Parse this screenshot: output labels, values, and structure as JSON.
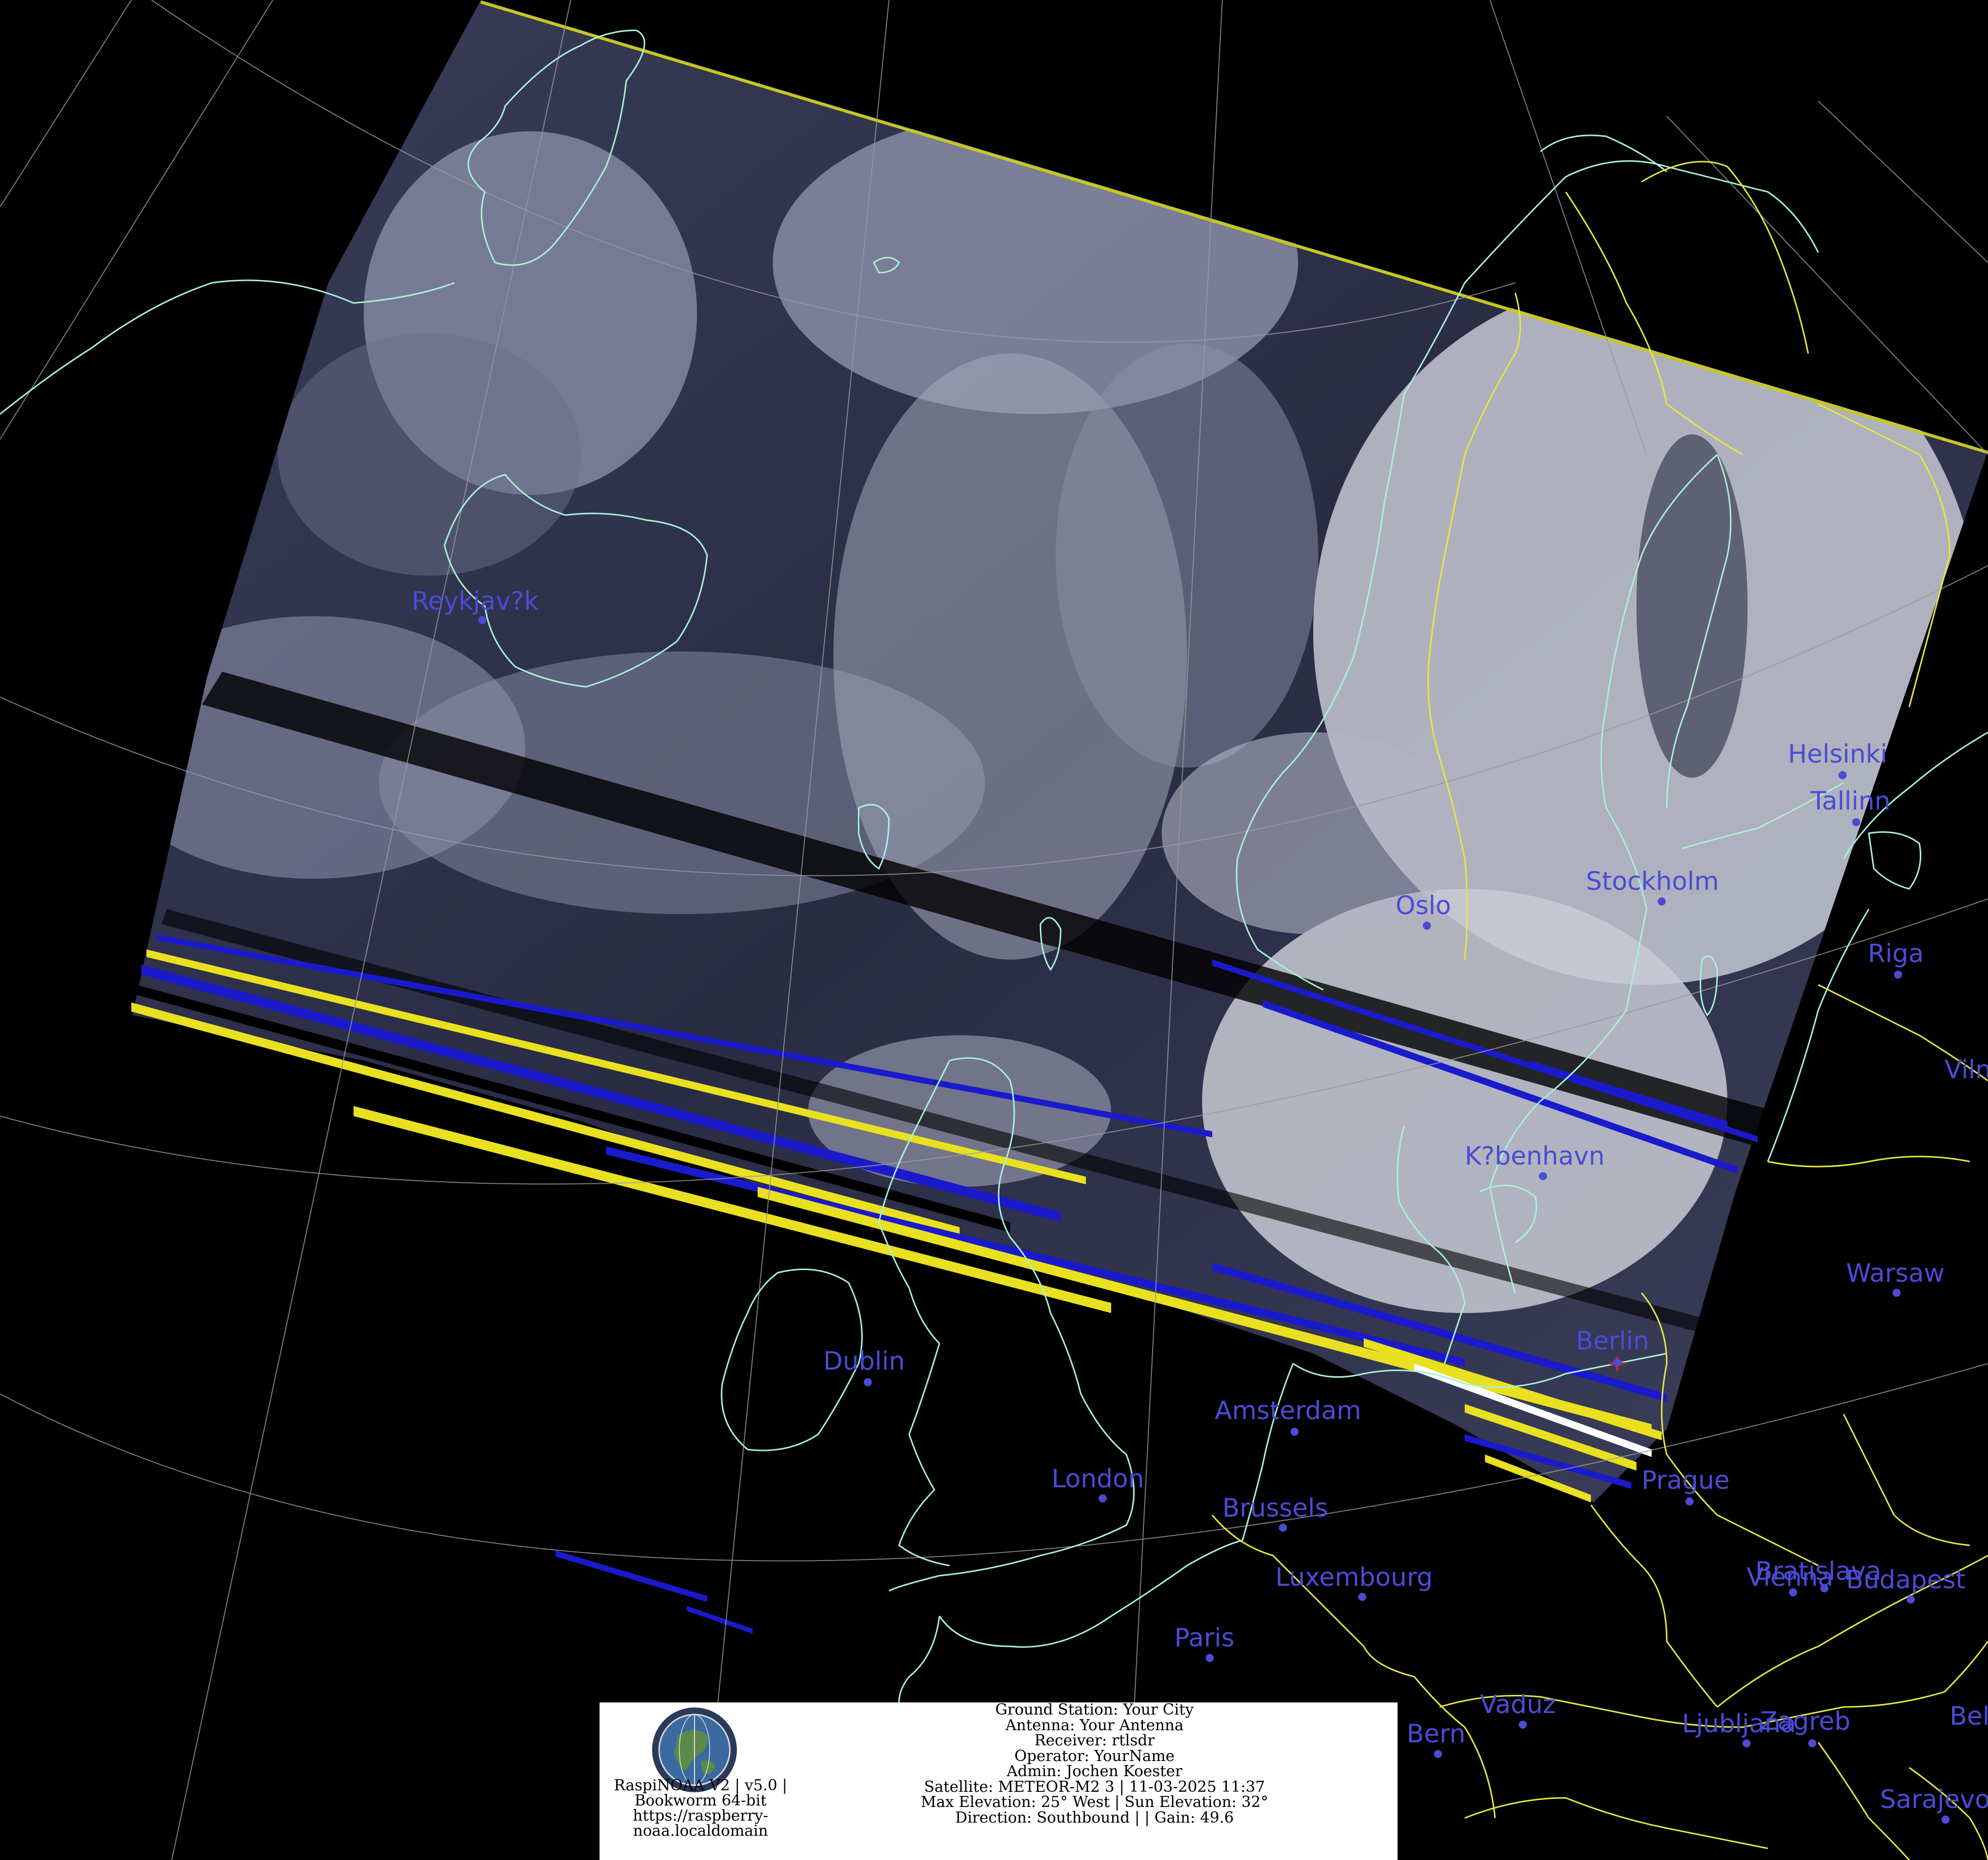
{
  "colors": {
    "background": "#000000",
    "coastline": "#a8f0d8",
    "border": "#e6e640",
    "graticule": "#9a9a9a",
    "city": "#4b4bd6",
    "home_marker": "#d02020",
    "swath_edge": "#c8c820",
    "artifact_blue": "#1a1acc",
    "artifact_yellow": "#e8e020"
  },
  "map": {
    "cities": [
      {
        "name": "Reykjav?k"
      },
      {
        "name": "Helsinki"
      },
      {
        "name": "Tallinn"
      },
      {
        "name": "Stockholm"
      },
      {
        "name": "Oslo"
      },
      {
        "name": "Riga"
      },
      {
        "name": "Vilnius"
      },
      {
        "name": "K?benhavn"
      },
      {
        "name": "Warsaw"
      },
      {
        "name": "Berlin"
      },
      {
        "name": "Dublin"
      },
      {
        "name": "Amsterdam"
      },
      {
        "name": "London"
      },
      {
        "name": "Brussels"
      },
      {
        "name": "Prague"
      },
      {
        "name": "Bratislava"
      },
      {
        "name": "Vienna"
      },
      {
        "name": "Budapest"
      },
      {
        "name": "Luxembourg"
      },
      {
        "name": "Paris"
      },
      {
        "name": "Bern"
      },
      {
        "name": "Vaduz"
      },
      {
        "name": "Ljubljana"
      },
      {
        "name": "Zagreb"
      },
      {
        "name": "Belgrade"
      },
      {
        "name": "Sarajevo"
      }
    ],
    "home_marker_icon": "plus-marker-icon"
  },
  "info": {
    "logo_icon": "raspinoaa-globe-logo-icon",
    "software_line1": "RaspiNOAA V2 | v5.0 |",
    "software_line2": "Bookworm 64-bit",
    "software_line3": "https://raspberry-",
    "software_line4": "noaa.localdomain",
    "ground_station": "Ground Station: Your City",
    "antenna": "Antenna: Your Antenna",
    "receiver": "Receiver: rtlsdr",
    "operator": "Operator: YourName",
    "admin": "Admin: Jochen Koester",
    "satellite": "Satellite: METEOR-M2 3 | 11-03-2025 11:37",
    "elevation": "Max Elevation: 25° West | Sun Elevation: 32°",
    "direction": "Direction: Southbound | | Gain: 49.6"
  }
}
